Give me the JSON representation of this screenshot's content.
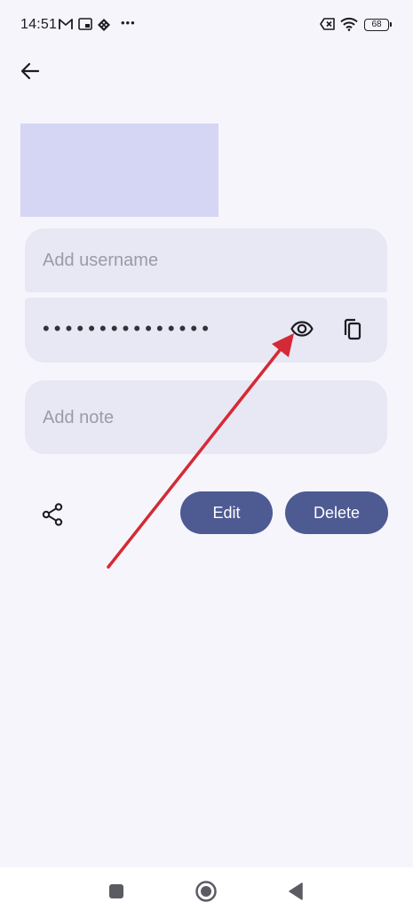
{
  "status_bar": {
    "time": "14:51",
    "more_label": "•••",
    "battery_level": "68",
    "icons": [
      "gmail-icon",
      "cast-icon",
      "app-icon",
      "more-icon",
      "no-sim-icon",
      "wifi-icon",
      "battery-icon"
    ]
  },
  "header": {
    "back_icon": "arrow-left-icon"
  },
  "credential": {
    "logo_color": "#d5d6f3",
    "username_placeholder": "Add username",
    "password_masked": "•••••••••••••••",
    "note_placeholder": "Add note",
    "show_password_icon": "eye-icon",
    "copy_password_icon": "copy-icon"
  },
  "actions": {
    "share_icon": "share-icon",
    "edit_label": "Edit",
    "delete_label": "Delete"
  },
  "colors": {
    "background": "#f7f5fc",
    "field_bg": "#e7e8f3",
    "button_bg": "#4e5a92",
    "annotation_arrow": "#d42a35"
  },
  "system_nav": {
    "items": [
      "recents-button",
      "home-button",
      "back-button"
    ]
  }
}
